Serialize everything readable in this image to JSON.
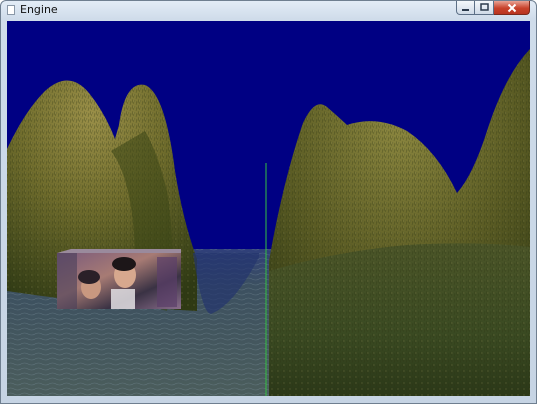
{
  "window": {
    "title": "Engine"
  },
  "scene": {
    "sky_color": "#000083",
    "water_color": "#3c4e58",
    "hill_color": "#6b6b2a"
  }
}
